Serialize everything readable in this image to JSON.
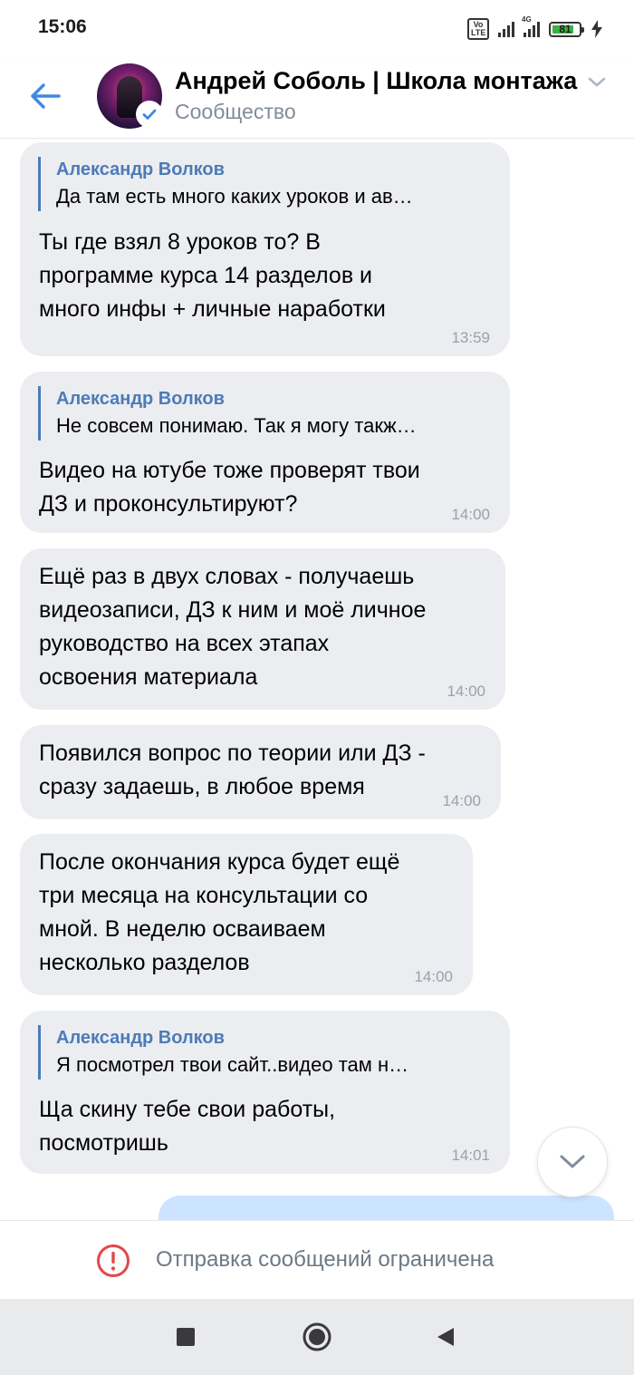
{
  "status_bar": {
    "time": "15:06",
    "volte": "Vo LTE",
    "network": "4G",
    "battery": "81",
    "battery_level": 0.81
  },
  "header": {
    "title": "Андрей Соболь | Школа монтажа",
    "subtitle": "Сообщество"
  },
  "messages": [
    {
      "reply_author": "Александр Волков",
      "reply_text": "Да там есть много каких уроков и ав…",
      "text": "Ты где взял 8 уроков то? В\nпрограмме курса 14 разделов и\nмного инфы + личные наработки",
      "time": "13:59"
    },
    {
      "reply_author": "Александр Волков",
      "reply_text": "Не совсем понимаю. Так я могу такж…",
      "text": "Видео на ютубе тоже проверят твои\nДЗ и проконсультируют?",
      "time": "14:00"
    },
    {
      "text": "Ещё раз в двух словах - получаешь\nвидеозаписи, ДЗ к ним и моё личное\nруководство на всех этапах\nосвоения материала",
      "time": "14:00"
    },
    {
      "text": "Появился вопрос по теории или ДЗ -\nсразу задаешь, в любое время",
      "time": "14:00"
    },
    {
      "text": "После окончания курса будет ещё\nтри месяца на консультации со\nмной. В неделю осваиваем\nнесколько разделов",
      "time": "14:00"
    },
    {
      "reply_author": "Александр Волков",
      "reply_text": "Я посмотрел твои сайт..видео там н…",
      "text": "Ща скину тебе свои работы,\nпосмотришь",
      "time": "14:01"
    }
  ],
  "restricted": {
    "text": "Отправка сообщений ограничена"
  },
  "colors": {
    "accent": "#4c7bb8",
    "incoming_bubble": "#ebedf0",
    "outgoing_bubble": "#cce4ff",
    "alert": "#e64646"
  }
}
